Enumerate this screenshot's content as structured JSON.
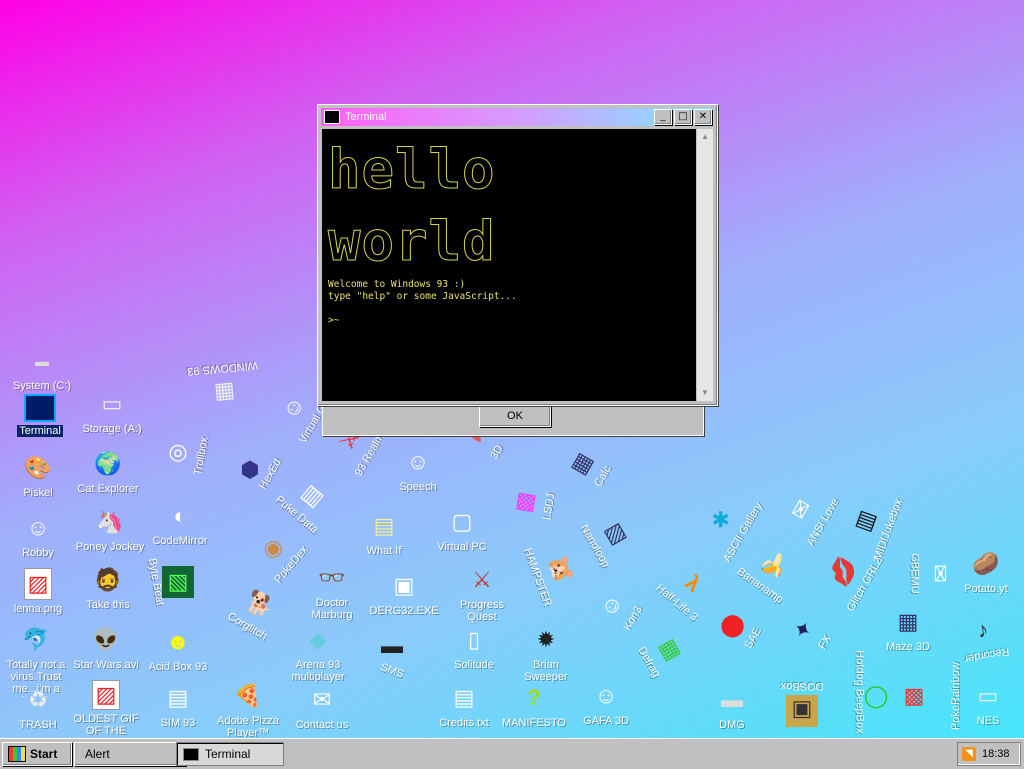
{
  "desktop": {
    "icons": [
      {
        "label": "System (C:)",
        "glyph": "▬",
        "name": "system-c-icon",
        "selected": false
      },
      {
        "label": "Terminal",
        "glyph": "▣",
        "name": "terminal-icon",
        "selected": true
      },
      {
        "label": "Piskel",
        "glyph": "🎨",
        "name": "piskel-icon",
        "selected": false
      },
      {
        "label": "Robby",
        "glyph": "☺",
        "name": "robby-icon",
        "selected": false
      },
      {
        "label": "lenna.png",
        "glyph": "▨",
        "name": "lenna-icon",
        "selected": false
      },
      {
        "label": "Totally not a virus.Trust me...i'm a dolphin",
        "glyph": "🐬",
        "name": "dolphin-icon",
        "selected": false
      },
      {
        "label": "TRASH",
        "glyph": "♻",
        "name": "trash-icon",
        "selected": false
      },
      {
        "label": "Storage (A:)",
        "glyph": "▭",
        "name": "storage-a-icon",
        "selected": false
      },
      {
        "label": "Cat Explorer",
        "glyph": "🌍",
        "name": "cat-explorer-icon",
        "selected": false
      },
      {
        "label": "Poney Jockey",
        "glyph": "🦄",
        "name": "poney-jockey-icon",
        "selected": false
      },
      {
        "label": "Take this",
        "glyph": "🧔",
        "name": "take-this-icon",
        "selected": false
      },
      {
        "label": "Star Wars.avi",
        "glyph": "👽",
        "name": "star-wars-icon",
        "selected": false
      },
      {
        "label": "OLDEST GIF OF THE",
        "glyph": "▨",
        "name": "oldest-gif-icon",
        "selected": false
      },
      {
        "label": "Trollbox",
        "glyph": "◎",
        "name": "trollbox-icon",
        "selected": false
      },
      {
        "label": "CodeMirror",
        "glyph": "◐",
        "name": "codemirror-icon",
        "selected": false
      },
      {
        "label": "Byte Beat",
        "glyph": "▧",
        "name": "byte-beat-icon",
        "selected": false
      },
      {
        "label": "Acid Box 93",
        "glyph": "☻",
        "name": "acid-box-icon",
        "selected": false
      },
      {
        "label": "SIM 93",
        "glyph": "▤",
        "name": "sim93-icon",
        "selected": false
      },
      {
        "label": "WINDOWS 93",
        "glyph": "▦",
        "name": "windows93-icon",
        "selected": false
      },
      {
        "label": "Virtual Girl",
        "glyph": "☺",
        "name": "virtual-girl-icon",
        "selected": false
      },
      {
        "label": "HexEd",
        "glyph": "⬢",
        "name": "hexed-icon",
        "selected": false
      },
      {
        "label": "93 Realms",
        "glyph": "⚔",
        "name": "93-realms-icon",
        "selected": false
      },
      {
        "label": "Puke Data",
        "glyph": "▥",
        "name": "puke-data-icon",
        "selected": false
      },
      {
        "label": "PokeDex",
        "glyph": "◉",
        "name": "pokedex-icon",
        "selected": false
      },
      {
        "label": "Corglitch",
        "glyph": "🐕",
        "name": "corglitch-icon",
        "selected": false
      },
      {
        "label": "Adobe Pizza Player™",
        "glyph": "🍕",
        "name": "pizza-player-icon",
        "selected": false
      },
      {
        "label": "Speech",
        "glyph": "☺",
        "name": "speech-icon",
        "selected": false
      },
      {
        "label": "What If",
        "glyph": "▤",
        "name": "what-if-icon",
        "selected": false
      },
      {
        "label": "Doctor Marburg",
        "glyph": "👓",
        "name": "doctor-marburg-icon",
        "selected": false
      },
      {
        "label": "Arena 93 multiplayer",
        "glyph": "◆",
        "name": "arena93-icon",
        "selected": false
      },
      {
        "label": "Contact us",
        "glyph": "✉",
        "name": "contact-us-icon",
        "selected": false
      },
      {
        "label": "DERG32.EXE",
        "glyph": "▣",
        "name": "derg32-icon",
        "selected": false
      },
      {
        "label": "SMS",
        "glyph": "▬",
        "name": "sms-icon",
        "selected": false
      },
      {
        "label": "3D",
        "glyph": "◑",
        "name": "3d-icon",
        "selected": false
      },
      {
        "label": "Virtual PC",
        "glyph": "▢",
        "name": "virtual-pc-icon",
        "selected": false
      },
      {
        "label": "Progress Quest",
        "glyph": "⚔",
        "name": "progress-quest-icon",
        "selected": false
      },
      {
        "label": "Solitude",
        "glyph": "▯",
        "name": "solitude-icon",
        "selected": false
      },
      {
        "label": "Credits.txt",
        "glyph": "▤",
        "name": "credits-icon",
        "selected": false
      },
      {
        "label": "Calc",
        "glyph": "▦",
        "name": "calc-icon",
        "selected": false
      },
      {
        "label": "LSDJ",
        "glyph": "▩",
        "name": "lsdj-icon",
        "selected": false
      },
      {
        "label": "HAMPSTER",
        "glyph": "🐹",
        "name": "hampster-icon",
        "selected": false
      },
      {
        "label": "Brian Sweeper",
        "glyph": "✹",
        "name": "brian-sweeper-icon",
        "selected": false
      },
      {
        "label": "MANIFESTO",
        "glyph": "?",
        "name": "manifesto-icon",
        "selected": false
      },
      {
        "label": "Nanoloop",
        "glyph": "▧",
        "name": "nanoloop-icon",
        "selected": false
      },
      {
        "label": "Kon3",
        "glyph": "☺",
        "name": "kon3-icon",
        "selected": false
      },
      {
        "label": "GAFA 3D",
        "glyph": "☺",
        "name": "gafa3d-icon",
        "selected": false
      },
      {
        "label": "ASCII Gallery",
        "glyph": "✱",
        "name": "ascii-gallery-icon",
        "selected": false
      },
      {
        "label": "Half-Life 3",
        "glyph": "λ",
        "name": "half-life-icon",
        "selected": false
      },
      {
        "label": "Defrag",
        "glyph": "▦",
        "name": "defrag-icon",
        "selected": false
      },
      {
        "label": "Bananamp",
        "glyph": "🍌",
        "name": "bananamp-icon",
        "selected": false
      },
      {
        "label": "SAE",
        "glyph": "⬤",
        "name": "sae-icon",
        "selected": false
      },
      {
        "label": "DMG",
        "glyph": "▬",
        "name": "dmg-icon",
        "selected": false
      },
      {
        "label": "ANSI Love",
        "glyph": "✉",
        "name": "ansi-love-icon",
        "selected": false
      },
      {
        "label": "FX",
        "glyph": "✦",
        "name": "fx-icon",
        "selected": false
      },
      {
        "label": "DOSBox",
        "glyph": "▣",
        "name": "dosbox-icon",
        "selected": false
      },
      {
        "label": "Glitch GRLZ",
        "glyph": "💋",
        "name": "glitch-grlz-icon",
        "selected": false
      },
      {
        "label": "MIDIJukebox",
        "glyph": "▥",
        "name": "midi-jukebox-icon",
        "selected": false
      },
      {
        "label": "Hotdog BeepBox",
        "glyph": "◯",
        "name": "beepbox-icon",
        "selected": false
      },
      {
        "label": "GBEMU",
        "glyph": "✉",
        "name": "gbemu-icon",
        "selected": false
      },
      {
        "label": "Maze 3D",
        "glyph": "▦",
        "name": "maze3d-icon",
        "selected": false
      },
      {
        "label": "PokeRainbow",
        "glyph": "▩",
        "name": "poke-rainbow-icon",
        "selected": false
      },
      {
        "label": "Potato.yt",
        "glyph": "🥔",
        "name": "potato-icon",
        "selected": false
      },
      {
        "label": "Recorder",
        "glyph": "♪",
        "name": "recorder-icon",
        "selected": false
      },
      {
        "label": "NES",
        "glyph": "▭",
        "name": "nes-icon",
        "selected": false
      }
    ]
  },
  "terminal": {
    "title": "Terminal",
    "ascii_line1": "hello",
    "ascii_line2": "world",
    "welcome": "Welcome to Windows 93 :)",
    "hint": "type \"help\" or some JavaScript...",
    "prompt": ">~"
  },
  "alert": {
    "ok_label": "OK"
  },
  "taskbar": {
    "start_label": "Start",
    "tasks": [
      "Alert",
      "Terminal"
    ],
    "clock": "18:38"
  }
}
